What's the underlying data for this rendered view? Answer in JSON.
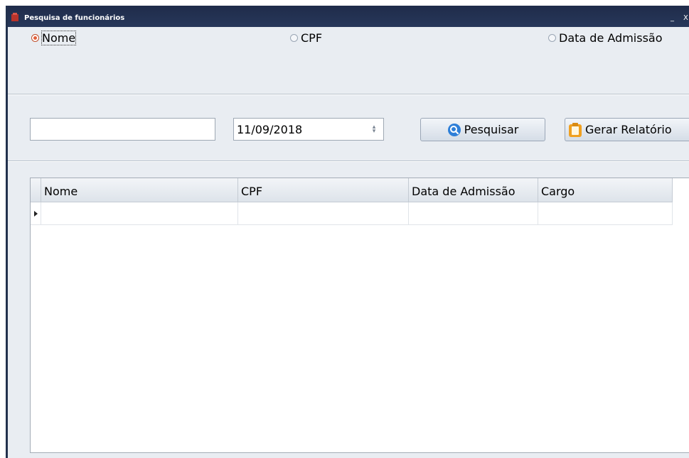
{
  "window": {
    "title": "Pesquisa de funcionários",
    "minimize_glyph": "_",
    "close_glyph": "X"
  },
  "search_mode": {
    "options": [
      {
        "label": "Nome",
        "selected": true
      },
      {
        "label": "CPF",
        "selected": false
      },
      {
        "label": "Data de Admissão",
        "selected": false
      }
    ]
  },
  "filters": {
    "text_value": "",
    "date_value": "11/09/2018"
  },
  "buttons": {
    "search_label": "Pesquisar",
    "report_label": "Gerar Relatório"
  },
  "icons": {
    "search": "magnifier-icon",
    "report": "clipboard-icon",
    "app": "app-icon"
  },
  "colors": {
    "titlebar": "#22314d",
    "radio_selected": "#e2603c",
    "search_icon": "#2e7fd8",
    "report_icon": "#f0a020"
  },
  "grid": {
    "columns": [
      "Nome",
      "CPF",
      "Data de Admissão",
      "Cargo"
    ],
    "rows": [
      [
        "",
        "",
        "",
        ""
      ]
    ]
  }
}
